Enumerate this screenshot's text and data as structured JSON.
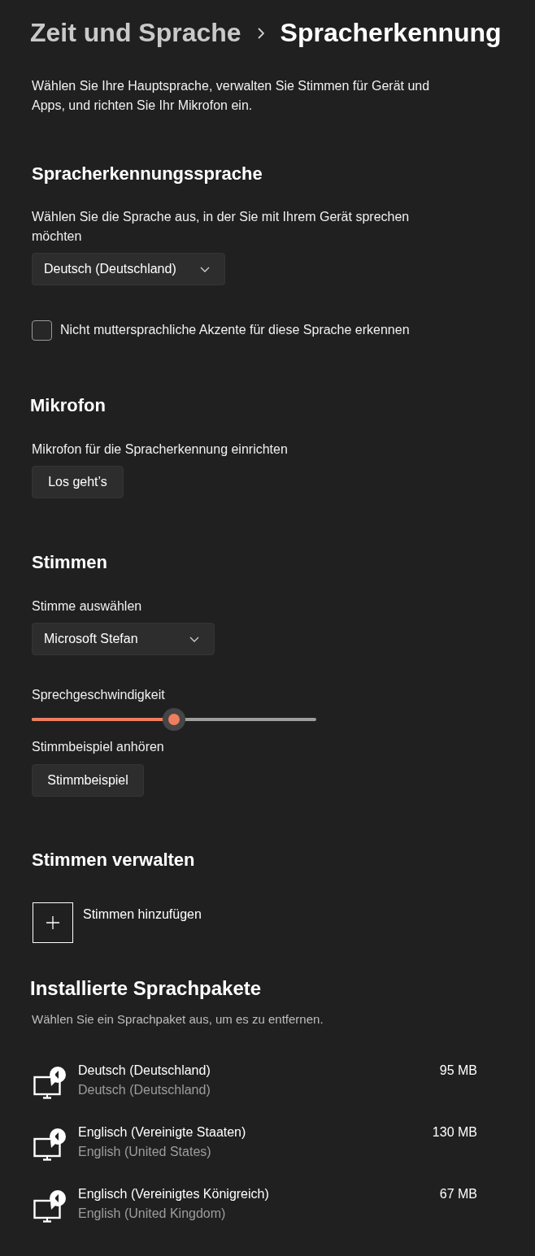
{
  "breadcrumb": {
    "parent": "Zeit und Sprache",
    "current": "Spracherkennung"
  },
  "description": "Wählen Sie Ihre Hauptsprache, verwalten Sie Stimmen für Gerät und Apps, und richten Sie Ihr Mikrofon ein.",
  "recognition_language": {
    "heading": "Spracherkennungssprache",
    "label": "Wählen Sie die Sprache aus, in der Sie mit Ihrem Gerät sprechen möchten",
    "dropdown": {
      "value": "Deutsch (Deutschland)"
    },
    "checkbox": {
      "label": "Nicht muttersprachliche Akzente für diese Sprache erkennen",
      "checked": false
    }
  },
  "microphone": {
    "heading": "Mikrofon",
    "label": "Mikrofon für die Spracherkennung einrichten",
    "button": "Los geht’s"
  },
  "voices": {
    "heading": "Stimmen",
    "voice_label": "Stimme auswählen",
    "voice_dropdown": {
      "value": "Microsoft Stefan"
    },
    "rate_label": "Sprechgeschwindigkeit",
    "rate_slider": {
      "level": 0.5
    },
    "sample_label": "Stimmbeispiel anhören",
    "sample_button": "Stimmbeispiel"
  },
  "manage_voices": {
    "heading": "Stimmen verwalten",
    "add_button": "Stimmen hinzufügen"
  },
  "language_packs": {
    "heading": "Installierte Sprachpakete",
    "hint": "Wählen Sie ein Sprachpaket aus, um es zu entfernen.",
    "items": [
      {
        "name": "Deutsch (Deutschland)",
        "subtitle": "Deutsch (Deutschland)",
        "size": "95 MB"
      },
      {
        "name": "Englisch (Vereinigte Staaten)",
        "subtitle": "English (United States)",
        "size": "130 MB"
      },
      {
        "name": "Englisch (Vereinigtes Königreich)",
        "subtitle": "English (United Kingdom)",
        "size": "67 MB"
      }
    ]
  }
}
